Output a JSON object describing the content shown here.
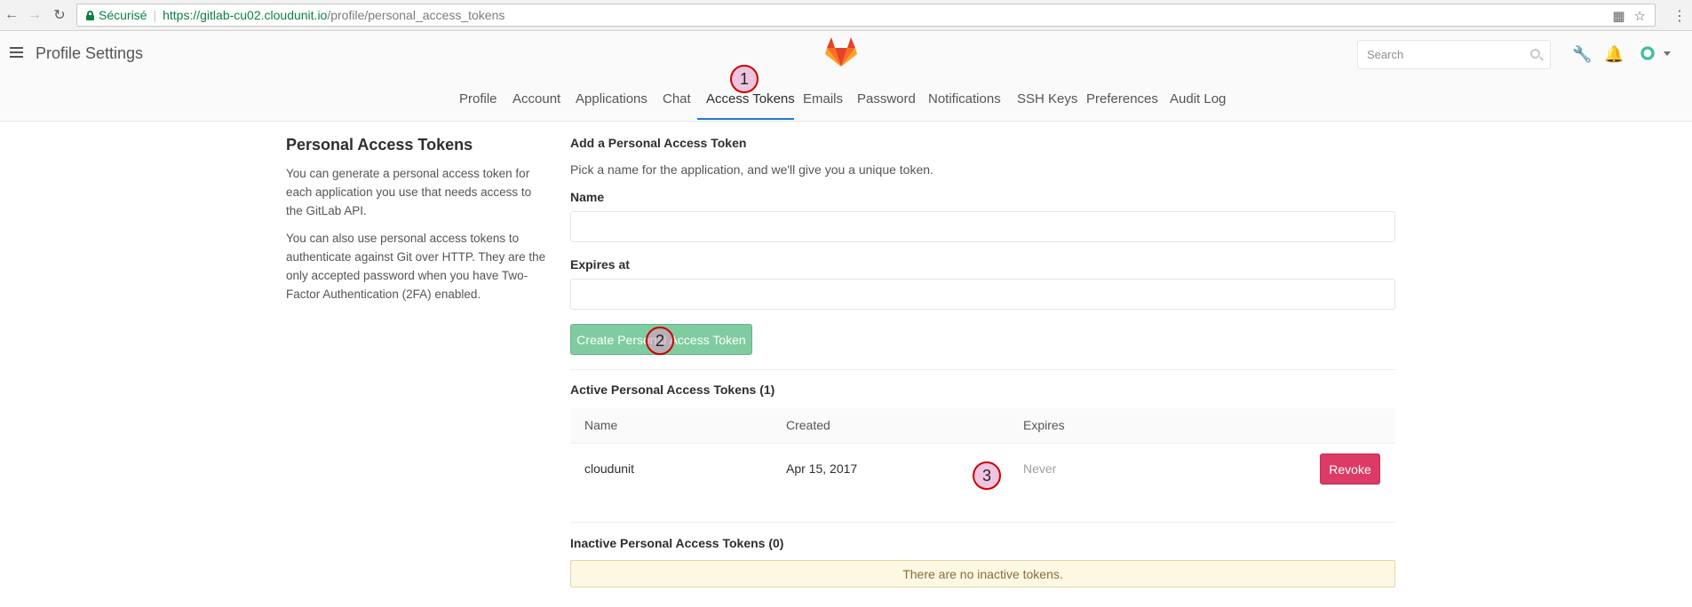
{
  "browser": {
    "secure_label": "Sécurisé",
    "url_host": "https://gitlab-cu02.cloudunit.io",
    "url_path": "/profile/personal_access_tokens"
  },
  "header": {
    "title": "Profile Settings",
    "search_placeholder": "Search"
  },
  "tabs": [
    {
      "label": "Profile"
    },
    {
      "label": "Account"
    },
    {
      "label": "Applications"
    },
    {
      "label": "Chat"
    },
    {
      "label": "Access Tokens",
      "active": true
    },
    {
      "label": "Emails"
    },
    {
      "label": "Password"
    },
    {
      "label": "Notifications"
    },
    {
      "label": "SSH Keys"
    },
    {
      "label": "Preferences"
    },
    {
      "label": "Audit Log"
    }
  ],
  "markers": [
    "1",
    "2",
    "3"
  ],
  "sidebar": {
    "title": "Personal Access Tokens",
    "para1": "You can generate a personal access token for each application you use that needs access to the GitLab API.",
    "para2": "You can also use personal access tokens to authenticate against Git over HTTP. They are the only accepted password when you have Two-Factor Authentication (2FA) enabled."
  },
  "form": {
    "heading": "Add a Personal Access Token",
    "description": "Pick a name for the application, and we'll give you a unique token.",
    "name_label": "Name",
    "name_value": "",
    "expires_label": "Expires at",
    "expires_value": "",
    "submit_label": "Create Personal Access Token"
  },
  "active_tokens": {
    "heading": "Active Personal Access Tokens (1)",
    "columns": [
      "Name",
      "Created",
      "Expires"
    ],
    "rows": [
      {
        "name": "cloudunit",
        "created": "Apr 15, 2017",
        "expires": "Never",
        "action": "Revoke"
      }
    ]
  },
  "inactive_tokens": {
    "heading": "Inactive Personal Access Tokens (0)",
    "empty_message": "There are no inactive tokens."
  },
  "colors": {
    "accent": "#1f78d1",
    "create_button": "#7fcca0",
    "revoke_button": "#db3b64",
    "warning_bg": "#fcf8e3"
  }
}
